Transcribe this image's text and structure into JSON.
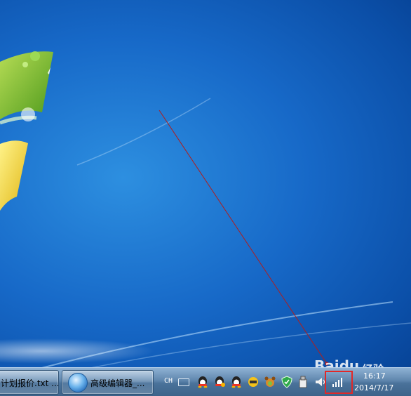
{
  "desktop": {
    "background_color": "#1769c8",
    "logo_name": "windows-7-logo"
  },
  "annotation": {
    "arrow_color": "#b01e1e",
    "highlight_color": "#e12828"
  },
  "watermark": {
    "text": "Baidu",
    "suffix": "经验"
  },
  "taskbar": {
    "buttons": [
      {
        "label": "计划报价.txt ...",
        "icon": "notepad-icon"
      },
      {
        "label": "高级编辑器_...",
        "icon": "ie-globe-icon"
      }
    ],
    "tray": {
      "language": "CH",
      "icons": [
        "keyboard-icon",
        "qq-icon",
        "qq-icon",
        "qq-icon",
        "app-icon",
        "pet-icon",
        "shield-icon",
        "usb-icon",
        "volume-icon",
        "network-signal-icon"
      ],
      "time": "16:17",
      "date": "2014/7/17"
    }
  }
}
